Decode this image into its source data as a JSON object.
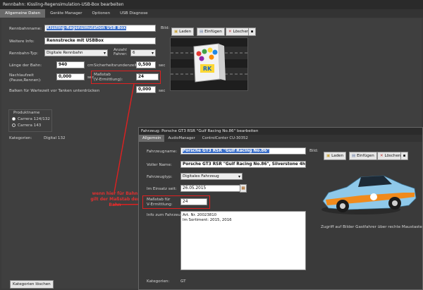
{
  "window_title": "Rennbahn: Kissling-Regensimulation-USB-Box bearbeiten",
  "tabs": [
    "Allgemeine Daten",
    "Geräte Manager",
    "Optionen",
    "USB Diagnose"
  ],
  "track": {
    "name_label": "Rennbahnname:",
    "name_value": "Kissling-Regensimulation USB Box",
    "info_label": "Weitere Info:",
    "info_value": "Rennstrecke mit USBBox",
    "type_label": "Rennbahn-Typ:",
    "type_value": "Digitale Rennbahn",
    "drivers_label": "Anzahl Fahrer:",
    "drivers_value": "6",
    "length_label": "Länge der Bahn:",
    "length_value": "940",
    "length_unit": "cm",
    "safety_label": "Sicherheitsrundenzeit:",
    "safety_value": "0,500",
    "safety_unit": "sec",
    "overrun_label": "Nachlaufzeit\n(Pause,Rennen):",
    "overrun_value": "0,000",
    "overrun_unit": "sec",
    "scale_label": "Maßstab\n(V-Ermittlung):",
    "scale_value": "24",
    "bar_label": "Balken für Wartezeit vor Tanken unterdrücken",
    "bar_value": "0,000",
    "bar_unit": "sec",
    "image_label": "Bild:",
    "btn_load": "Laden",
    "btn_paste": "Einfügen",
    "btn_delete": "Löschen",
    "product_label": "Produktname",
    "product_opt1": "Carrera 124/132",
    "product_opt2": "Carrera 143",
    "categories_label": "Kategorien:",
    "categories_value": "Digital 132",
    "clear_categories": "Kategorien löschen",
    "rk_logo": "RK"
  },
  "annotation": "wenn hier für Bahn\ngilt der Maßstab der\nBahn",
  "vehicle": {
    "title": "Fahrzeug: Porsche GT3 RSR \"Gulf Racing No.86\" bearbeiten",
    "tabs": [
      "Allgemein",
      "AudioManager",
      "ControlCenter CU-30352"
    ],
    "name_label": "Fahrzeugname:",
    "name_value": "Porsche GT3 RSR \"Gulf Racing No.86\"",
    "full_label": "Voller Name:",
    "full_value": "Porsche GT3 RSR \"Gulf Racing No.86\", Silverstone 4h 2014",
    "type_label": "Fahrzeugtyp:",
    "type_value": "Digitales Fahrzeug",
    "since_label": "Im Einsatz seit:",
    "since_value": "26.05.2015",
    "scale_label": "Maßstab für\nV-Ermittlung:",
    "scale_value": "24",
    "info_label": "Info zum Fahrzeug:",
    "info_value": "Art. Nr. 20023810\nIm Sortiment: 2015, 2016",
    "image_label": "Bild:",
    "btn_load": "Laden",
    "btn_paste": "Einfügen",
    "btn_delete": "Löschen",
    "hint": "Zugriff auf Bilder Gastfahrer über rechte Maustaste (Mehr Bil",
    "categories_label": "Kategorien:",
    "categories_value": "GT"
  }
}
